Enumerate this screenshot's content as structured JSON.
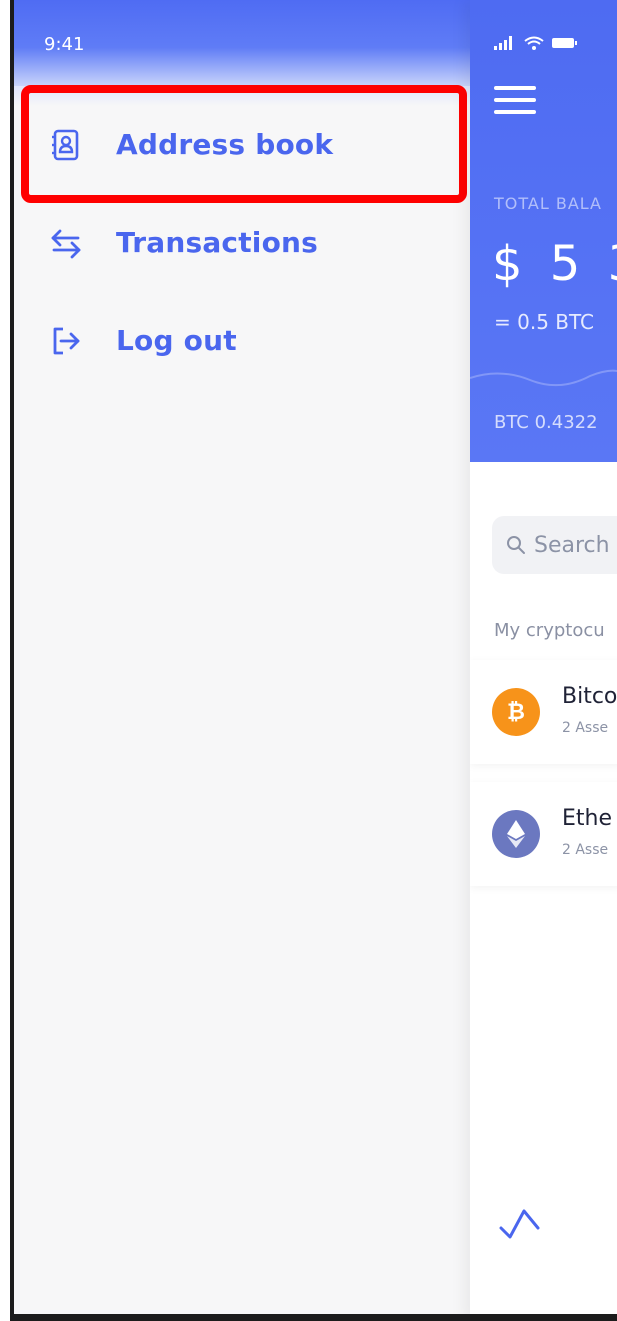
{
  "status_bar": {
    "time": "9:41"
  },
  "drawer": {
    "items": [
      {
        "label": "Address book",
        "icon": "address-book-icon"
      },
      {
        "label": "Transactions",
        "icon": "transfer-arrows-icon"
      },
      {
        "label": "Log out",
        "icon": "logout-icon"
      }
    ]
  },
  "main": {
    "total_label": "TOTAL BALA",
    "total_amount": "$ 5 3",
    "btc_equivalent": "= 0.5 BTC",
    "btc_line": "BTC 0.4322",
    "search_placeholder": "Search",
    "section_label": "My cryptocu",
    "coins": [
      {
        "name": "Bitco",
        "subtitle": "2 Asse",
        "color": "#f7931a",
        "icon": "bitcoin-icon"
      },
      {
        "name": "Ethe",
        "subtitle": "2 Asse",
        "color": "#6b78c0",
        "icon": "ethereum-icon"
      }
    ]
  },
  "colors": {
    "accent": "#4a66ee",
    "header_blue": "#5a77f5",
    "highlight": "#ff0000"
  }
}
